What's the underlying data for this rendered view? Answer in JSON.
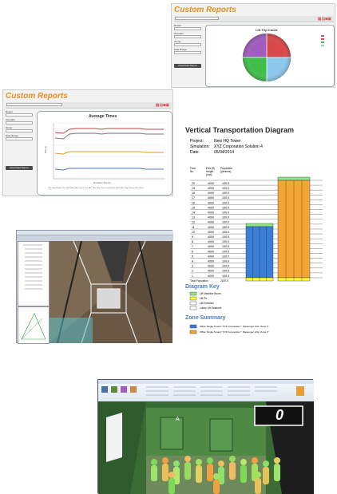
{
  "report_top": {
    "title": "Custom Reports",
    "chart_title": "Lift Trip Count",
    "button": "Download Report",
    "fields": [
      "Report",
      "Lift Trip Count",
      "Scenario",
      "XYZ Corporation",
      "Group",
      "All",
      "Date Range",
      "All Day"
    ],
    "legend": [
      "Lift 1",
      "Lift 2",
      "Lift 3",
      "Lift 4"
    ],
    "colors": {
      "purple": "#a05cc0",
      "red": "#d94848",
      "green": "#3fbf4a",
      "blue": "#8cc8ee"
    }
  },
  "report_mid": {
    "title": "Custom Reports",
    "chart_title": "Average Times",
    "button": "Download Report",
    "fields": [
      "Report",
      "Average Times",
      "Scenario",
      "XYZ Corporation",
      "Group",
      "All",
      "Date Range",
      "All Day"
    ],
    "xlabel": "Simulation Time (h)",
    "ylabel": "Time (s)",
    "legend_text": "Ave. Avg Waiting Time (ATT)    Ave. Avg Transit Time (ATT)    Ave. Avg Time to Destination (ATD)    Ave. Avg Journey Time (AJT)"
  },
  "vtd": {
    "title": "Vertical Transportation Diagram",
    "project_label": "Project:",
    "project": "New HQ Tower",
    "simulation_label": "Simulation:",
    "simulation": "XYZ Corporation Solution 4",
    "date_label": "Date:",
    "date": "05/04/2014",
    "col_floor": "Floor No.",
    "col_height": "Elev.(ft) Height (mm)",
    "col_pop": "Population (persons)",
    "floors": [
      "20",
      "19",
      "18",
      "17",
      "16",
      "15",
      "14",
      "13",
      "12",
      "11",
      "10",
      "9",
      "8",
      "7",
      "6",
      "5",
      "4",
      "3",
      "2",
      "1"
    ],
    "height_value": "4000",
    "pop_value": "100.0",
    "total_label": "Total Population",
    "total_value": "2100.0",
    "key_title": "Diagram Key",
    "key_items": [
      "Lift Machine Room",
      "Lift Pit",
      "Lift Entrance",
      "Lobby Lift Entrance"
    ],
    "zone_title": "Zone Summary",
    "zones": [
      "Office Single Tenant \"XYZ Corporation\": Passenger Lifts \"Zone 1\"",
      "Office Single Tenant \"XYZ Corporation\": Passenger Lifts \"Zone 2\""
    ],
    "colors": {
      "green": "#8ee58a",
      "yellow": "#ffff33",
      "blue": "#3b7ed6",
      "orange": "#f4a533"
    }
  },
  "sim_overlay": {
    "letter": "A",
    "counter": "0"
  }
}
